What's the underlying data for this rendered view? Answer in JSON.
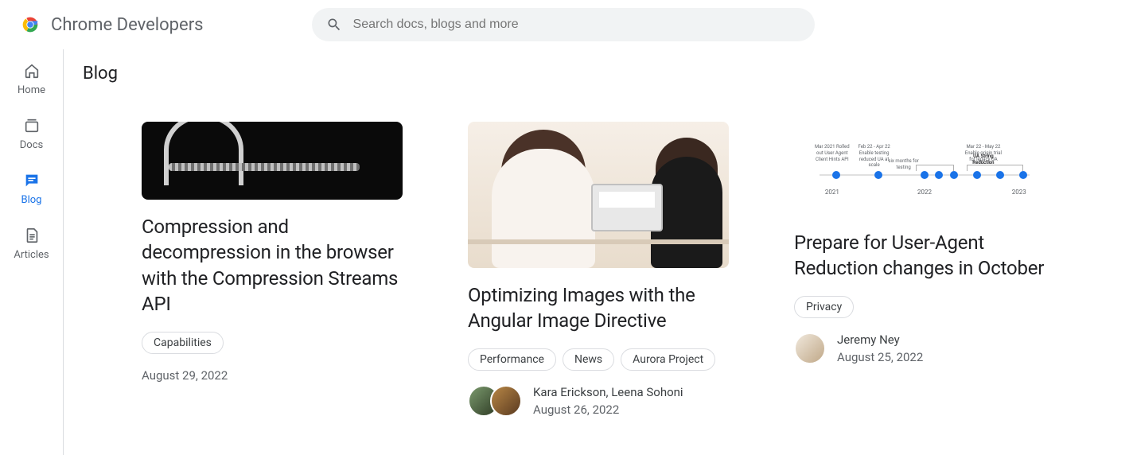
{
  "header": {
    "site_title": "Chrome Developers",
    "search_placeholder": "Search docs, blogs and more"
  },
  "sidebar": {
    "items": [
      {
        "label": "Home"
      },
      {
        "label": "Docs"
      },
      {
        "label": "Blog"
      },
      {
        "label": "Articles"
      }
    ]
  },
  "page": {
    "title": "Blog"
  },
  "cards": [
    {
      "title": "Compression and decompression in the browser with the Compression Streams API",
      "tags": [
        "Capabilities"
      ],
      "authors": "",
      "date": "August 29, 2022"
    },
    {
      "title": "Optimizing Images with the Angular Image Directive",
      "tags": [
        "Performance",
        "News",
        "Aurora Project"
      ],
      "authors": "Kara Erickson, Leena Sohoni",
      "date": "August 26, 2022"
    },
    {
      "title": "Prepare for User-Agent Reduction changes in October",
      "tags": [
        "Privacy"
      ],
      "authors": "Jeremy Ney",
      "date": "August 25, 2022"
    }
  ],
  "timeline_img": {
    "ticks": [
      {
        "top": "Mar 2021\nRolled out User Agent Client Hints API"
      },
      {
        "top": "Feb 22 - Apr 22\nEnable testing reduced UA at scale"
      },
      {
        "top": "six months for testing"
      },
      {
        "top": ""
      },
      {
        "top": ""
      },
      {
        "top": "Mar 22 - May 22\nEnable origin trial for legacy UA"
      },
      {
        "top": "UA String Reduction"
      },
      {
        "top": ""
      }
    ],
    "axis": [
      "2021",
      "2022",
      "2023"
    ]
  }
}
